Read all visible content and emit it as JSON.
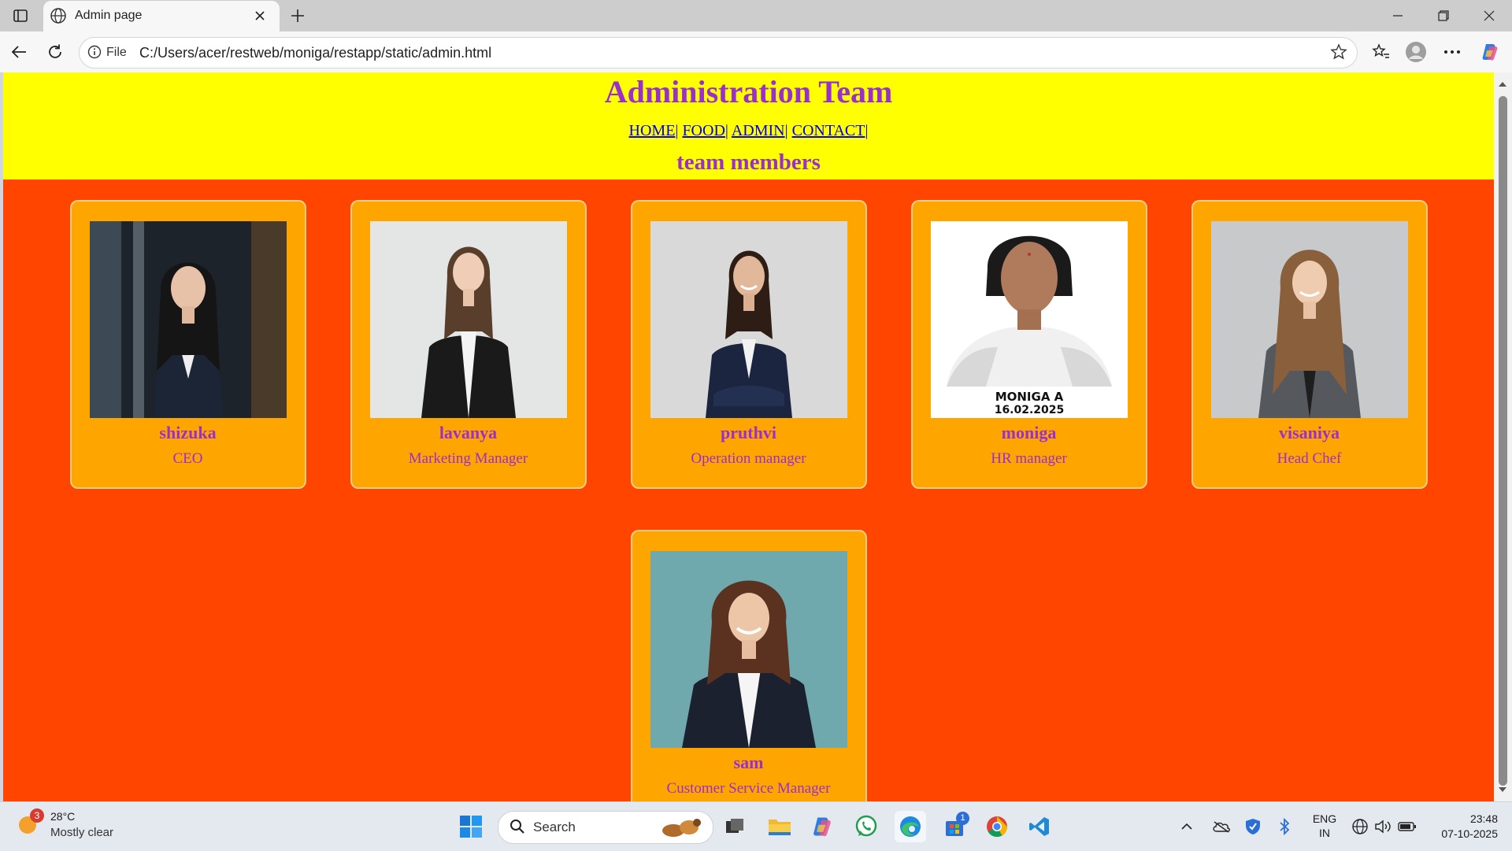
{
  "browser": {
    "tab_title": "Admin page",
    "address_prefix": "File",
    "url": "C:/Users/acer/restweb/moniga/restapp/static/admin.html"
  },
  "page": {
    "title": "Administration Team",
    "nav": [
      {
        "label": "HOME"
      },
      {
        "label": "FOOD"
      },
      {
        "label": "ADMIN"
      },
      {
        "label": "CONTACT"
      }
    ],
    "nav_separator": "|",
    "team_heading": "team members",
    "members": [
      {
        "name": "shizuka",
        "role": "CEO"
      },
      {
        "name": "lavanya",
        "role": "Marketing Manager"
      },
      {
        "name": "pruthvi",
        "role": "Operation manager"
      },
      {
        "name": "moniga",
        "role": "HR manager",
        "photo_caption_line1": "MONIGA A",
        "photo_caption_line2": "16.02.2025"
      },
      {
        "name": "visaniya",
        "role": "Head Chef"
      },
      {
        "name": "sam",
        "role": "Customer Service Manager"
      }
    ]
  },
  "taskbar": {
    "weather_temp": "28°C",
    "weather_condition": "Mostly clear",
    "weather_badge": "3",
    "search_placeholder": "Search",
    "store_badge": "1",
    "language_line1": "ENG",
    "language_line2": "IN",
    "time": "23:48",
    "date": "07-10-2025"
  },
  "colors": {
    "header_bg": "#ffff00",
    "page_bg": "#ff4500",
    "card_bg": "#ffa500",
    "title_text": "#9a2fd0"
  }
}
